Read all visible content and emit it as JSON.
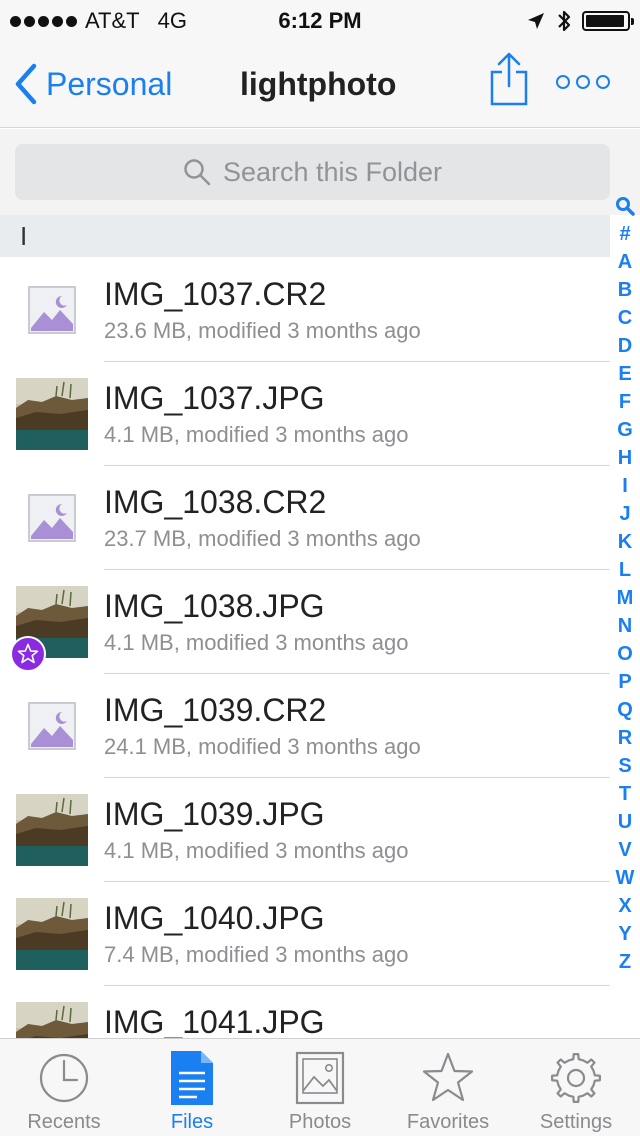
{
  "status_bar": {
    "carrier": "AT&T",
    "network": "4G",
    "time": "6:12 PM",
    "battery_level": 0.95
  },
  "nav": {
    "back_label": "Personal",
    "title": "lightphoto"
  },
  "search": {
    "placeholder": "Search this Folder"
  },
  "section": {
    "header": "I"
  },
  "index_letters": [
    "#",
    "A",
    "B",
    "C",
    "D",
    "E",
    "F",
    "G",
    "H",
    "I",
    "J",
    "K",
    "L",
    "M",
    "N",
    "O",
    "P",
    "Q",
    "R",
    "S",
    "T",
    "U",
    "V",
    "W",
    "X",
    "Y",
    "Z"
  ],
  "files": [
    {
      "name": "IMG_1037.CR2",
      "meta": "23.6 MB, modified 3 months ago",
      "thumb": "generic-image-icon",
      "favorite": false
    },
    {
      "name": "IMG_1037.JPG",
      "meta": "4.1 MB, modified 3 months ago",
      "thumb": "photo",
      "favorite": false
    },
    {
      "name": "IMG_1038.CR2",
      "meta": "23.7 MB, modified 3 months ago",
      "thumb": "generic-image-icon",
      "favorite": false
    },
    {
      "name": "IMG_1038.JPG",
      "meta": "4.1 MB, modified 3 months ago",
      "thumb": "photo",
      "favorite": true
    },
    {
      "name": "IMG_1039.CR2",
      "meta": "24.1 MB, modified 3 months ago",
      "thumb": "generic-image-icon",
      "favorite": false
    },
    {
      "name": "IMG_1039.JPG",
      "meta": "4.1 MB, modified 3 months ago",
      "thumb": "photo",
      "favorite": false
    },
    {
      "name": "IMG_1040.JPG",
      "meta": "7.4 MB, modified 3 months ago",
      "thumb": "photo",
      "favorite": false
    },
    {
      "name": "IMG_1041.JPG",
      "meta": "",
      "thumb": "photo",
      "favorite": false
    }
  ],
  "tabs": [
    {
      "label": "Recents",
      "icon": "clock-icon",
      "active": false
    },
    {
      "label": "Files",
      "icon": "document-icon",
      "active": true
    },
    {
      "label": "Photos",
      "icon": "photo-icon",
      "active": false
    },
    {
      "label": "Favorites",
      "icon": "star-icon",
      "active": false
    },
    {
      "label": "Settings",
      "icon": "gear-icon",
      "active": false
    }
  ],
  "colors": {
    "accent": "#1a7ff0",
    "favorite_badge": "#8a2be2",
    "tab_inactive": "#8a8a8f"
  }
}
